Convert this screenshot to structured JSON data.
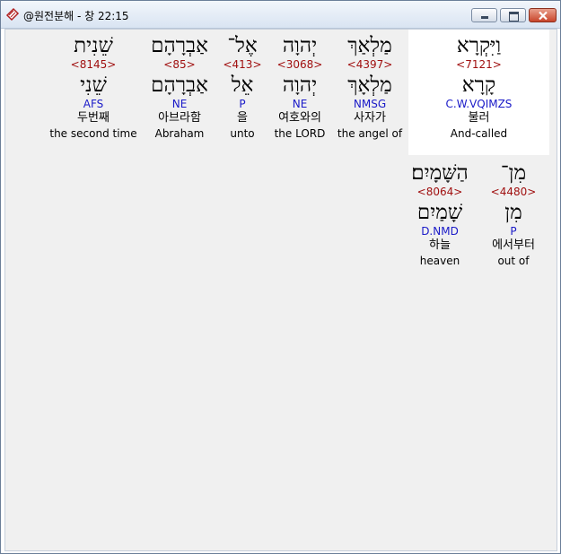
{
  "window": {
    "title": "@원전분해 - 창 22:15",
    "app_icon": "bible-book-icon",
    "controls": {
      "minimize_icon": "minimize-icon",
      "maximize_icon": "maximize-icon",
      "close_icon": "close-icon"
    }
  },
  "colors": {
    "strong_number": "#a01010",
    "morphology": "#1a1ac8",
    "highlight_background": "#ffffff",
    "panel_background": "#f0f0f0"
  },
  "verse": {
    "row1": [
      {
        "heb": "וַיִּקְרָא",
        "strong": "<7121>",
        "lemma": "קָרָא",
        "morph": "C.W.VQIMZS",
        "korean": "불러",
        "english": "And-called",
        "selected": true
      },
      {
        "heb": "מַלְאַךְ",
        "strong": "<4397>",
        "lemma": "מַלְאָךְ",
        "morph": "NMSG",
        "korean": "사자가",
        "english": "the angel of"
      },
      {
        "heb": "יְהוָה",
        "strong": "<3068>",
        "lemma": "יְהוָה",
        "morph": "NE",
        "korean": "여호와의",
        "english": "the LORD"
      },
      {
        "heb": "אֶל־",
        "strong": "<413>",
        "lemma": "אֵל",
        "morph": "P",
        "korean": "을",
        "english": "unto"
      },
      {
        "heb": "אַבְרָהָם",
        "strong": "<85>",
        "lemma": "אַבְרָהָם",
        "morph": "NE",
        "korean": "아브라함",
        "english": "Abraham"
      },
      {
        "heb": "שֵׁנִית",
        "strong": "<8145>",
        "lemma": "שֵׁנִי",
        "morph": "AFS",
        "korean": "두번째",
        "english": "the second time"
      }
    ],
    "row2": [
      {
        "heb": "מִן־",
        "strong": "<4480>",
        "lemma": "מִן",
        "morph": "P",
        "korean": "에서부터",
        "english": "out of"
      },
      {
        "heb": "הַשָּׁמָיִם׃",
        "strong": "<8064>",
        "lemma": "שָׁמַיִם",
        "morph": "D.NMD",
        "korean": "하늘",
        "english": "heaven"
      }
    ]
  }
}
